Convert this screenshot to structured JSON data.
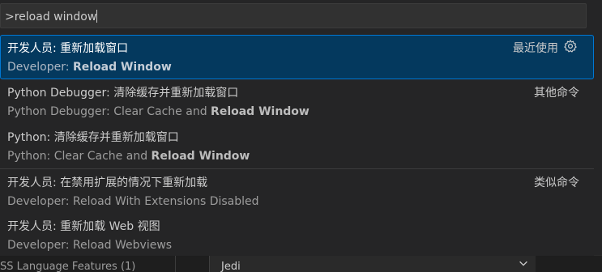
{
  "command_palette": {
    "query": ">reload window",
    "items": [
      {
        "label": "开发人员: 重新加载窗口",
        "detail_prefix": "Developer: ",
        "detail_highlight": "Reload Window",
        "detail_suffix": "",
        "group": "最近使用",
        "gear_icon": "gear-icon",
        "selected": true
      },
      {
        "label": "Python Debugger: 清除缓存并重新加载窗口",
        "detail_prefix": "Python Debugger: Clear Cache and ",
        "detail_highlight": "Reload Window",
        "detail_suffix": "",
        "group": "其他命令"
      },
      {
        "label": "Python: 清除缓存并重新加载窗口",
        "detail_prefix": "Python: Clear Cache and ",
        "detail_highlight": "Reload Window",
        "detail_suffix": "",
        "group": ""
      },
      {
        "label": "开发人员: 在禁用扩展的情况下重新加载",
        "detail_prefix": "Developer: Reload With Extensions Disabled",
        "detail_highlight": "",
        "detail_suffix": "",
        "group": "类似命令"
      },
      {
        "label": "开发人员: 重新加载 Web 视图",
        "detail_prefix": "Developer: Reload Webviews",
        "detail_highlight": "",
        "detail_suffix": "",
        "group": ""
      }
    ]
  },
  "background": {
    "left_text": "SS Language Features (1)",
    "right_dropdown_value": "Jedi",
    "chevron_icon": "chevron-down-icon"
  },
  "colors": {
    "selection_bg": "#04395e",
    "selection_border": "#0078d4",
    "widget_bg": "#252526"
  }
}
